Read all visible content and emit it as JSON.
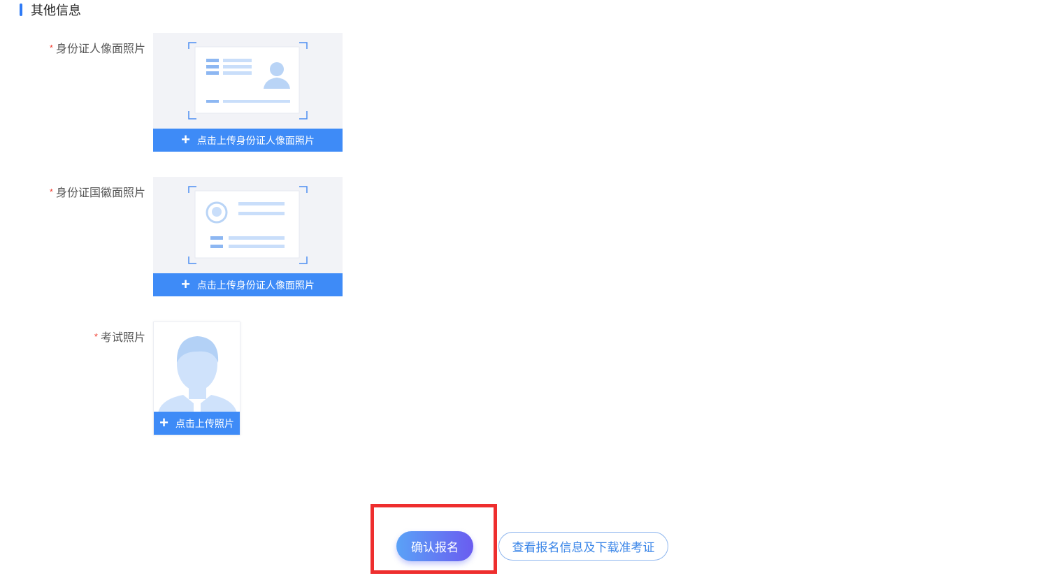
{
  "section": {
    "title": "其他信息"
  },
  "fields": [
    {
      "required_mark": "*",
      "label": "身份证人像面照片",
      "upload_label": "点击上传身份证人像面照片"
    },
    {
      "required_mark": "*",
      "label": "身份证国徽面照片",
      "upload_label": "点击上传身份证人像面照片"
    },
    {
      "required_mark": "*",
      "label": "考试照片",
      "upload_label": "点击上传照片"
    }
  ],
  "actions": {
    "confirm_label": "确认报名",
    "view_label": "查看报名信息及下载准考证"
  },
  "colors": {
    "accent": "#3e8bf7",
    "required": "#f04134",
    "highlight": "#ee2e2e"
  }
}
